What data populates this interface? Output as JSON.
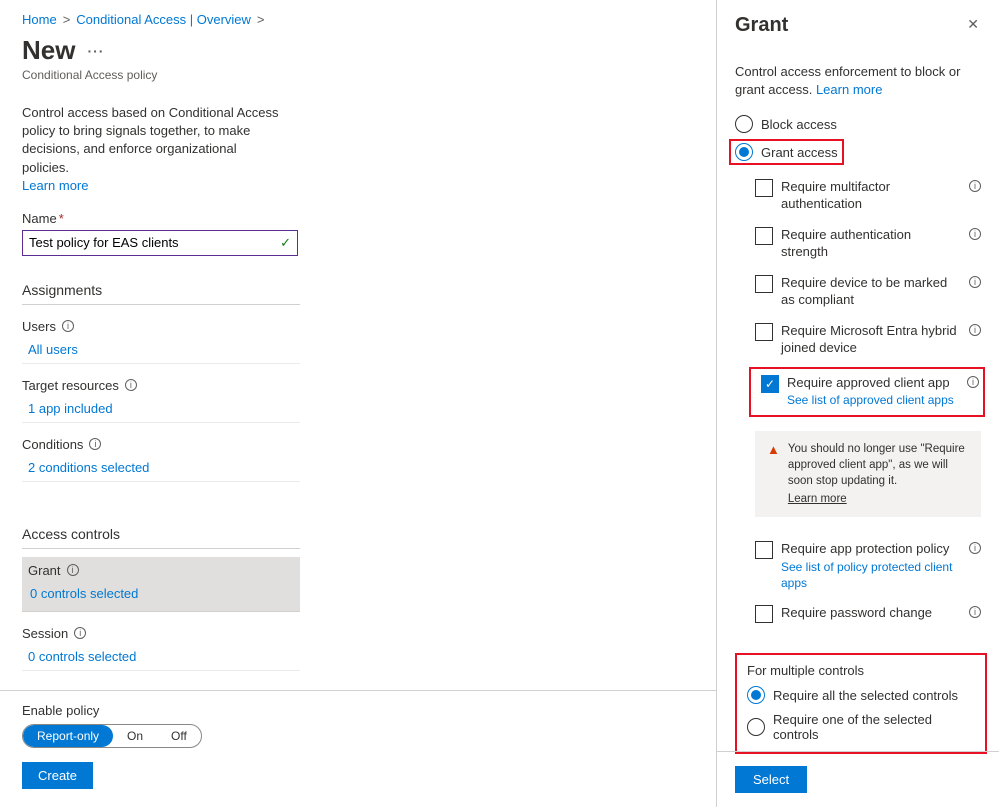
{
  "breadcrumb": {
    "home": "Home",
    "ca": "Conditional Access | Overview"
  },
  "page": {
    "title": "New",
    "subtitle": "Conditional Access policy"
  },
  "intro": {
    "text": "Control access based on Conditional Access policy to bring signals together, to make decisions, and enforce organizational policies.",
    "learn": "Learn more"
  },
  "name": {
    "label": "Name",
    "value": "Test policy for EAS clients"
  },
  "assignments": {
    "heading": "Assignments",
    "users_label": "Users",
    "users_value": "All users",
    "targets_label": "Target resources",
    "targets_value": "1 app included",
    "cond_label": "Conditions",
    "cond_value": "2 conditions selected"
  },
  "access": {
    "heading": "Access controls",
    "grant_label": "Grant",
    "grant_value": "0 controls selected",
    "session_label": "Session",
    "session_value": "0 controls selected"
  },
  "footer": {
    "label": "Enable policy",
    "opt1": "Report-only",
    "opt2": "On",
    "opt3": "Off",
    "create": "Create"
  },
  "panel": {
    "title": "Grant",
    "desc": "Control access enforcement to block or grant access.",
    "learn": "Learn more",
    "block": "Block access",
    "grant": "Grant access",
    "chk_mfa": "Require multifactor authentication",
    "chk_auth": "Require authentication strength",
    "chk_compliant": "Require device to be marked as compliant",
    "chk_hybrid": "Require Microsoft Entra hybrid joined device",
    "chk_approved": "Require approved client app",
    "chk_approved_link": "See list of approved client apps",
    "warn_text": "You should no longer use \"Require approved client app\", as we will soon stop updating it.",
    "warn_link": "Learn more",
    "chk_protection": "Require app protection policy",
    "chk_protection_link": "See list of policy protected client apps",
    "chk_pwd": "Require password change",
    "multi_head": "For multiple controls",
    "multi_all": "Require all the selected controls",
    "multi_one": "Require one of the selected controls",
    "select": "Select"
  }
}
